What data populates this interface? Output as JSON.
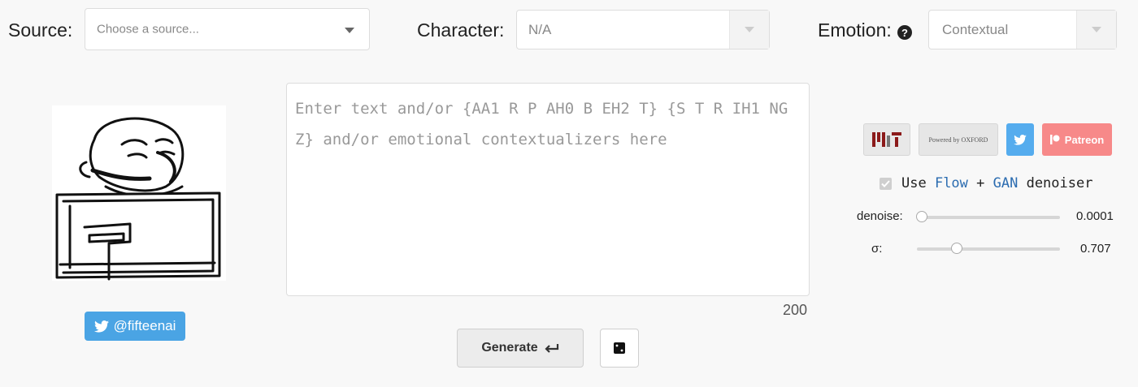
{
  "header": {
    "source_label": "Source:",
    "source_placeholder": "Choose a source...",
    "character_label": "Character:",
    "character_value": "N/A",
    "emotion_label": "Emotion:",
    "emotion_value": "Contextual"
  },
  "editor": {
    "placeholder": "Enter text and/or {AA1 R P AH0 B EH2 T} {S T R IH1 NG Z} and/or emotional contextualizers here",
    "char_counter": "200"
  },
  "actions": {
    "generate_label": "Generate"
  },
  "profile": {
    "twitter_handle": "@fifteenai"
  },
  "sponsors": {
    "mit": "MIT",
    "oxford": "Powered by OXFORD",
    "patreon": "Patreon"
  },
  "denoiser": {
    "prefix": "Use ",
    "flow": "Flow",
    "plus": " + ",
    "gan": "GAN",
    "suffix": " denoiser",
    "checked": true
  },
  "sliders": {
    "denoise_label": "denoise:",
    "denoise_value": "0.0001",
    "denoise_fraction": 0.0001,
    "sigma_label": "σ:",
    "sigma_value": "0.707",
    "sigma_fraction": 0.27
  },
  "colors": {
    "twitter": "#4aa4e4",
    "patreon": "#f78989",
    "keyword": "#2b6cb0"
  }
}
